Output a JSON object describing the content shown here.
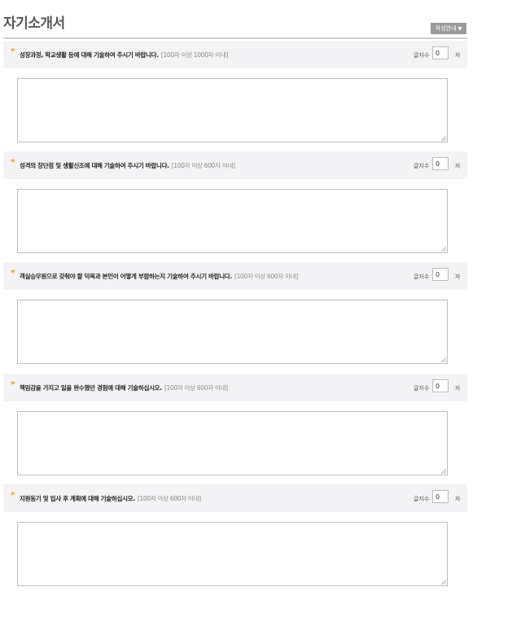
{
  "page": {
    "title": "자기소개서",
    "guide_button": {
      "label": "작성안내",
      "caret": "▼"
    }
  },
  "questions": [
    {
      "star": "*",
      "text": "성장과정, 학교생활 등에 대해 기술하여 주시기 바랍니다.",
      "limit": "[100자 이상 1000자 이내]",
      "count_label": "글자수",
      "count_value": "0",
      "count_unit": "자",
      "answer": ""
    },
    {
      "star": "*",
      "text": "성격의 장단점 및 생활신조에 대해 기술하여 주시기 바랍니다.",
      "limit": "[100자 이상 600자 이내]",
      "count_label": "글자수",
      "count_value": "0",
      "count_unit": "자",
      "answer": ""
    },
    {
      "star": "*",
      "text": "객실승무원으로 갖춰야 할 덕목과 본인이 어떻게 부합하는지 기술하여 주시기 바랍니다.",
      "limit": "[100자 이상 600자 이내]",
      "count_label": "글자수",
      "count_value": "0",
      "count_unit": "자",
      "answer": ""
    },
    {
      "star": "*",
      "text": "책임감을 가지고 일을 완수했던 경험에 대해 기술하십시오.",
      "limit": "[100자 이상 600자 이내]",
      "count_label": "글자수",
      "count_value": "0",
      "count_unit": "자",
      "answer": ""
    },
    {
      "star": "*",
      "text": "지원동기 및 입사 후 계획에 대해 기술하십시오.",
      "limit": "[100자 이상 600자 이내]",
      "count_label": "글자수",
      "count_value": "0",
      "count_unit": "자",
      "answer": ""
    }
  ],
  "colors": {
    "accent_star": "#f29a1a",
    "header_bg": "#f3f3f5",
    "guide_button_bg": "#9a9a9a"
  }
}
